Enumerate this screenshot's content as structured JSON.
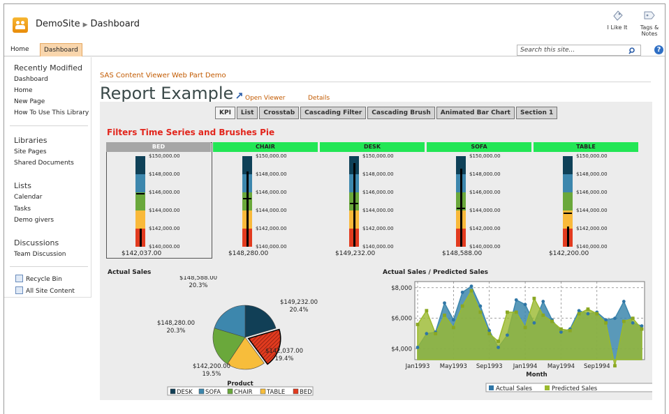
{
  "header": {
    "site": "DemoSite",
    "page": "Dashboard",
    "like": "I Like It",
    "tags": "Tags &",
    "tags2": "Notes"
  },
  "nav": {
    "home": "Home",
    "dashboard": "Dashboard",
    "search_placeholder": "Search this site..."
  },
  "leftnav": {
    "recently_modified": "Recently Modified",
    "recent": [
      "Dashboard",
      "Home",
      "New Page",
      "How To Use This Library"
    ],
    "libraries": "Libraries",
    "libs": [
      "Site Pages",
      "Shared Documents"
    ],
    "lists": "Lists",
    "list_items": [
      "Calendar",
      "Tasks",
      "Demo givers"
    ],
    "discussions": "Discussions",
    "disc_items": [
      "Team Discussion"
    ],
    "recycle": "Recycle Bin",
    "all_content": "All Site Content"
  },
  "main": {
    "webpart_title": "SAS Content Viewer Web Part Demo",
    "report_title": "Report Example",
    "open_viewer": "Open Viewer",
    "details": "Details",
    "tabs": [
      "KPI",
      "List",
      "Crosstab",
      "Cascading Filter",
      "Cascading Brush",
      "Animated Bar Chart",
      "Section 1"
    ],
    "section_title": "Filters Time Series and Brushes Pie"
  },
  "kpi": {
    "ticks": [
      "$150,000.00",
      "$148,000.00",
      "$146,000.00",
      "$144,000.00",
      "$142,000.00",
      "$140,000.00"
    ],
    "items": [
      {
        "name": "BED",
        "value": "$142,037.00",
        "num": 142037
      },
      {
        "name": "CHAIR",
        "value": "$148,280.00",
        "num": 148280
      },
      {
        "name": "DESK",
        "value": "$149,232.00",
        "num": 149232
      },
      {
        "name": "SOFA",
        "value": "$148,588.00",
        "num": 148588
      },
      {
        "name": "TABLE",
        "value": "$142,200.00",
        "num": 142200
      }
    ],
    "band_colors": [
      "#0f4158",
      "#3d87ad",
      "#6aa83b",
      "#f9b93a",
      "#e23b1f"
    ]
  },
  "pie": {
    "title": "Actual Sales",
    "legend_title": "Product",
    "slices": [
      {
        "name": "DESK",
        "value": 149232,
        "label": "$149,232.00",
        "pct": "20.4%",
        "color": "#113f56"
      },
      {
        "name": "BED",
        "value": 142037,
        "label": "$142,037.00",
        "pct": "19.4%",
        "color": "#e23b1f"
      },
      {
        "name": "TABLE",
        "value": 142200,
        "label": "$142,200.00",
        "pct": "19.5%",
        "color": "#f7bd3b"
      },
      {
        "name": "CHAIR",
        "value": 148280,
        "label": "$148,280.00",
        "pct": "20.3%",
        "color": "#6aa83b"
      },
      {
        "name": "SOFA",
        "value": 148588,
        "label": "$148,588.00",
        "pct": "20.3%",
        "color": "#3d87ad"
      }
    ],
    "legend": [
      "DESK",
      "SOFA",
      "CHAIR",
      "TABLE",
      "BED"
    ]
  },
  "chart_data": {
    "type": "area",
    "title": "Actual Sales / Predicted Sales",
    "xlabel": "Month",
    "ylabel": "",
    "x_ticks": [
      "Jan1993",
      "May1993",
      "Sep1993",
      "Jan1994",
      "May1994",
      "Sep1994"
    ],
    "y_ticks": [
      "$4,000",
      "$6,000",
      "$8,000"
    ],
    "ylim": [
      3300,
      8400
    ],
    "grid": true,
    "legend": "bottom",
    "series": [
      {
        "name": "Actual Sales",
        "color": "#3d87ad",
        "values": [
          4100,
          5000,
          5100,
          7000,
          5900,
          7700,
          8100,
          6800,
          5200,
          4100,
          4900,
          7200,
          6900,
          5700,
          7100,
          5900,
          5100,
          5300,
          6500,
          6300,
          6400,
          5900,
          6000,
          7100,
          5700,
          5500
        ]
      },
      {
        "name": "Predicted Sales",
        "color": "#9ab92e",
        "values": [
          5600,
          6500,
          5000,
          6200,
          5400,
          6800,
          7800,
          6400,
          5000,
          4500,
          6400,
          6400,
          5400,
          7300,
          6200,
          5800,
          5300,
          5200,
          6300,
          6600,
          6300,
          5700,
          2900,
          5800,
          6000,
          5300
        ]
      }
    ]
  }
}
